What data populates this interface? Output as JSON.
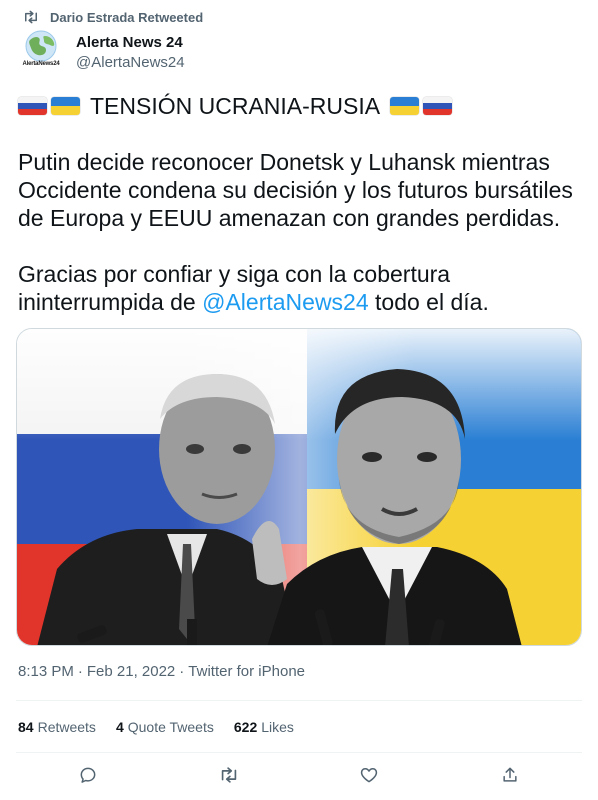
{
  "retweet": {
    "icon": "retweet-icon",
    "text": "Dario Estrada Retweeted"
  },
  "author": {
    "avatar_icon": "globe-logo-icon",
    "avatar_caption": "AlertaNews24",
    "name": "Alerta News 24",
    "handle": "@AlertaNews24"
  },
  "tweet": {
    "headline": "TENSIÓN UCRANIA-RUSIA",
    "flags_left": [
      "russia-flag-icon",
      "ukraine-flag-icon"
    ],
    "flags_right": [
      "ukraine-flag-icon",
      "russia-flag-icon"
    ],
    "body_lines": [
      "Putin decide reconocer Donetsk y Luhansk mientras",
      "Occidente condena su decisión y los futuros bursátiles",
      "de Europa y EEUU amenazan con grandes perdidas."
    ],
    "closing_line1": "Gracias por confiar y siga con la cobertura",
    "closing_pre": "ininterrumpida de ",
    "closing_mention": "@AlertaNews24",
    "closing_post": " todo el día."
  },
  "media": {
    "alt": "Putin and Zelensky in front of Russian and Ukrainian flags",
    "colors": {
      "ru_white": "#f4f4f4",
      "ru_blue": "#2f55b8",
      "ru_red": "#e1352c",
      "ua_blue": "#2a7fd4",
      "ua_yellow": "#f6d134"
    }
  },
  "meta": {
    "time": "8:13 PM",
    "sep": "·",
    "date": "Feb 21, 2022",
    "sep2": "·",
    "source": "Twitter for iPhone"
  },
  "stats": [
    {
      "count": "84",
      "label": "Retweets"
    },
    {
      "count": "4",
      "label": "Quote Tweets"
    },
    {
      "count": "622",
      "label": "Likes"
    }
  ],
  "actions": [
    "reply-icon",
    "retweet-icon",
    "like-icon",
    "share-icon"
  ],
  "colors": {
    "accent": "#1d9bf0",
    "secondary_text": "#536471",
    "text": "#0f1419",
    "divider": "#eff3f4"
  }
}
